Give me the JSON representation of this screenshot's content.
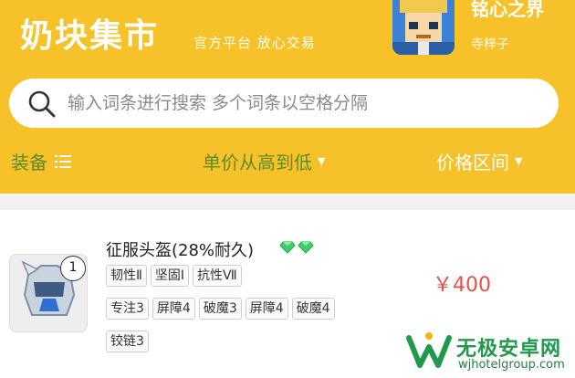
{
  "header": {
    "title": "奶块集市",
    "slogan": "官方平台 放心交易",
    "server_name": "铭心之界",
    "user_name": "寺梓子",
    "background_color": "#f7c229"
  },
  "search": {
    "placeholder": "输入词条进行搜索 多个词条以空格分隔"
  },
  "filters": {
    "equipment_label": "装备",
    "equipment_icon": "list-icon",
    "sort_label": "单价从高到低",
    "price_label": "价格区间"
  },
  "listing": {
    "items": [
      {
        "name": "征服头盔(28%耐久)",
        "count": "1",
        "gem_icon": "green-gem-icon",
        "gem_count": 2,
        "tags_row1": [
          "韧性Ⅱ",
          "坚固Ⅰ",
          "抗性Ⅶ"
        ],
        "tags_row2": [
          "专注3",
          "屏障4",
          "破魔3",
          "屏障4",
          "破魔4"
        ],
        "tags_row3": [
          "铰链3"
        ],
        "price": "￥400",
        "price_color": "#e0534a"
      }
    ]
  },
  "watermark": {
    "title": "无极安卓网",
    "url": "wjhotelgroup.com",
    "color": "#1f9a4b"
  }
}
